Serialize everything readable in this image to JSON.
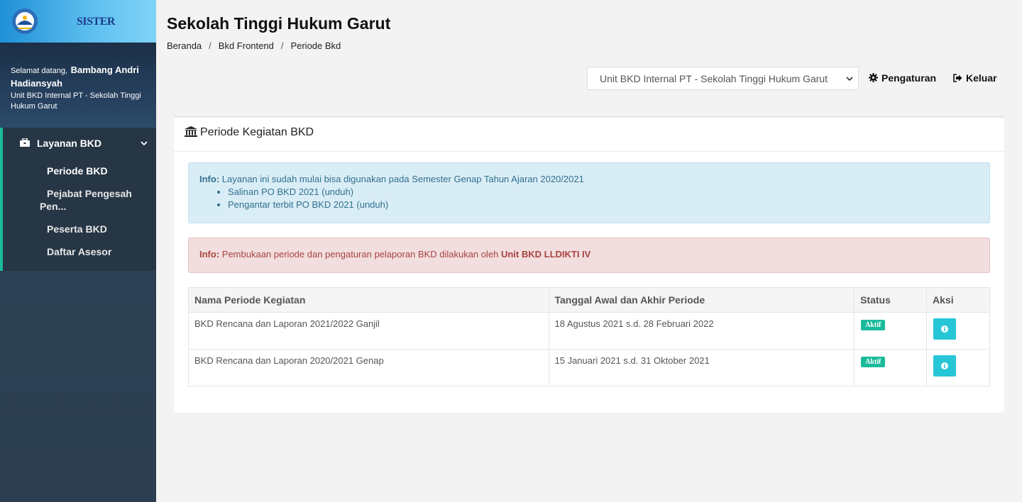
{
  "sidebar": {
    "brand": "SISTER",
    "welcome_prefix": "Selamat datang,",
    "user_name": "Bambang Andri Hadiansyah",
    "user_unit": "Unit BKD Internal PT - Sekolah Tinggi Hukum Garut",
    "menu_group": "Layanan BKD",
    "items": [
      {
        "label": "Periode BKD",
        "active": true
      },
      {
        "label_line1": "Pejabat Pengesah",
        "label_line2": "Pen..."
      },
      {
        "label": "Peserta BKD"
      },
      {
        "label": "Daftar Asesor"
      }
    ]
  },
  "header": {
    "title": "Sekolah Tinggi Hukum Garut",
    "breadcrumb": [
      "Beranda",
      "Bkd Frontend",
      "Periode Bkd"
    ],
    "unit_selected": "Unit BKD Internal PT - Sekolah Tinggi Hukum Garut",
    "settings_label": "Pengaturan",
    "logout_label": "Keluar"
  },
  "panel": {
    "title": "Periode Kegiatan BKD",
    "info": {
      "label": "Info:",
      "text": "Layanan ini sudah mulai bisa digunakan pada Semester Genap Tahun Ajaran 2020/2021",
      "links": [
        "Salinan PO BKD 2021 (unduh)",
        "Pengantar terbit PO BKD 2021 (unduh)"
      ]
    },
    "warning": {
      "label": "Info:",
      "text": "Pembukaan periode dan pengaturan pelaporan BKD dilakukan oleh",
      "emphasis": "Unit BKD LLDIKTI IV"
    },
    "table": {
      "headers": [
        "Nama Periode Kegiatan",
        "Tanggal Awal dan Akhir Periode",
        "Status",
        "Aksi"
      ],
      "rows": [
        {
          "name": "BKD Rencana dan Laporan 2021/2022 Ganjil",
          "range": "18 Agustus 2021 s.d. 28 Februari 2022",
          "status": "Aktif"
        },
        {
          "name": "BKD Rencana dan Laporan 2020/2021 Genap",
          "range": "15 Januari 2021 s.d. 31 Oktober 2021",
          "status": "Aktif"
        }
      ]
    }
  },
  "colors": {
    "sidebar_bg": "#2c3e50",
    "accent_green": "#1abb9c",
    "info_button": "#26c6d6",
    "alert_info_bg": "#d9edf6",
    "alert_danger_bg": "#f2dede"
  },
  "icons": [
    "kemendikbud-logo",
    "briefcase-icon",
    "chevron-down-icon",
    "gear-icon",
    "sign-out-icon",
    "bank-icon",
    "info-icon"
  ]
}
